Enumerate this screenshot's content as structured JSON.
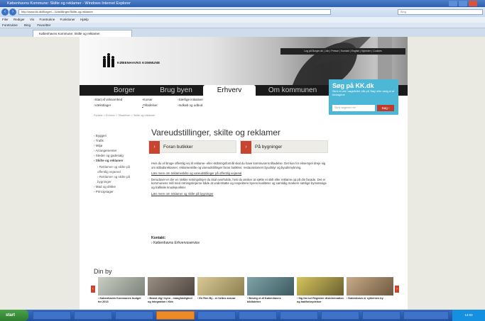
{
  "browser": {
    "window_title": "Københavns Kommune: Skilte og reklamer - Windows Internet Explorer",
    "url": "http://www.kk.dk/Borger/.../Udstillinger/Skilte-og-reklamer",
    "search_placeholder": "Bing",
    "menu": [
      "Filer",
      "Rediger",
      "Vis",
      "Foretrukne",
      "Funktioner",
      "Hjælp"
    ],
    "favbar": {
      "favorites_label": "Foretrukne",
      "bing_label": "Bing",
      "bar_label": "Favoritter"
    },
    "tab_label": "Københavns Kommune: Skilte og reklamer"
  },
  "site": {
    "top_links": "Log på Borger.dk | Job | Presse | Kontakt | English | Nyheder | Cookies",
    "logo_text": "KØBENHAVNS KOMMUNE",
    "nav": [
      "Borger",
      "Brug byen",
      "Erhverv",
      "Om kommunen"
    ],
    "search": {
      "title": "Søg på KK.dk",
      "subtitle": "Skriv et ord i søgefeltet, klik på 'Søg' eller vælg et af forslagene",
      "placeholder": "Skriv søgeord her",
      "button": "Søg"
    },
    "subnav": {
      "col1": [
        "Start af virksomhed",
        "Vækstlager"
      ],
      "col2": [
        "Kurser",
        "Tilladelser"
      ],
      "col3": [
        "Særlige initiativer",
        "Indkøb og udbud"
      ]
    },
    "breadcrumb": "Forside > Erhverv > Tilladelser > Skilte og reklamer"
  },
  "left_nav": {
    "items": [
      "Byggeri",
      "Trafik",
      "Miljø",
      "Arrangementer",
      "Steder og gadesalg",
      "Skilte og reklamer"
    ],
    "subitems": [
      "Reklamer og skilte på offentlig vejareal",
      "Reklamer og skilte på bygninger"
    ],
    "after": [
      "Mad og drikke",
      "Principsager"
    ]
  },
  "main": {
    "heading": "Vareudstillinger, skilte og reklamer",
    "btn1": "Foran butikker",
    "btn2": "På bygninger",
    "para1": "Hvis du vil bruge offentlig vej til reklame- eller skiltningsformål skal du have kommunens tilladelse. Det kan for eksempel dreje sig om stillads­reklamer, reklameskilte og vareudstillinger foran butikker, restaurationers byudstyr og byudsmykning.",
    "link1": "Læs mere om reklameskilte og vareudstillinger på offentlig vejareal",
    "para2": "Derudover er der en række retningslinjer du skal overholde, hvis du ønsker at sætte et skilt eller reklame op på din facade. Det er kommunens mål med retningslinjerne både at understøtte og respektere byens kvaliteter og samtidig markere særlige bymæssige og trafikale knudepunkter.",
    "link2": "Læs mere om reklamer og skilte på bygninger",
    "contact_title": "Kontakt:",
    "contact_link": "Københavns Erhvervsservice"
  },
  "din_by": {
    "title": "Din by",
    "items": [
      {
        "caption": "Københavns Kommunes budget for 2013",
        "color": "#9aa094"
      },
      {
        "caption": "Brand dig i byen - mangfoldighed og integration i Kbh",
        "color": "#7a6f64"
      },
      {
        "caption": "En Ren By - er heltes ansvar",
        "color": "#b5a67a"
      },
      {
        "caption": "Bevæg et af Københavns biblioteker",
        "color": "#5f7f85"
      },
      {
        "caption": "Sig fra nu! Registrer diskrimination og hadforbrydelser",
        "color": "#9c8a40"
      },
      {
        "caption": "København er cyklernes by",
        "color": "#a38a6c"
      }
    ]
  },
  "taskbar": {
    "start": "start",
    "clock": "14:02"
  }
}
